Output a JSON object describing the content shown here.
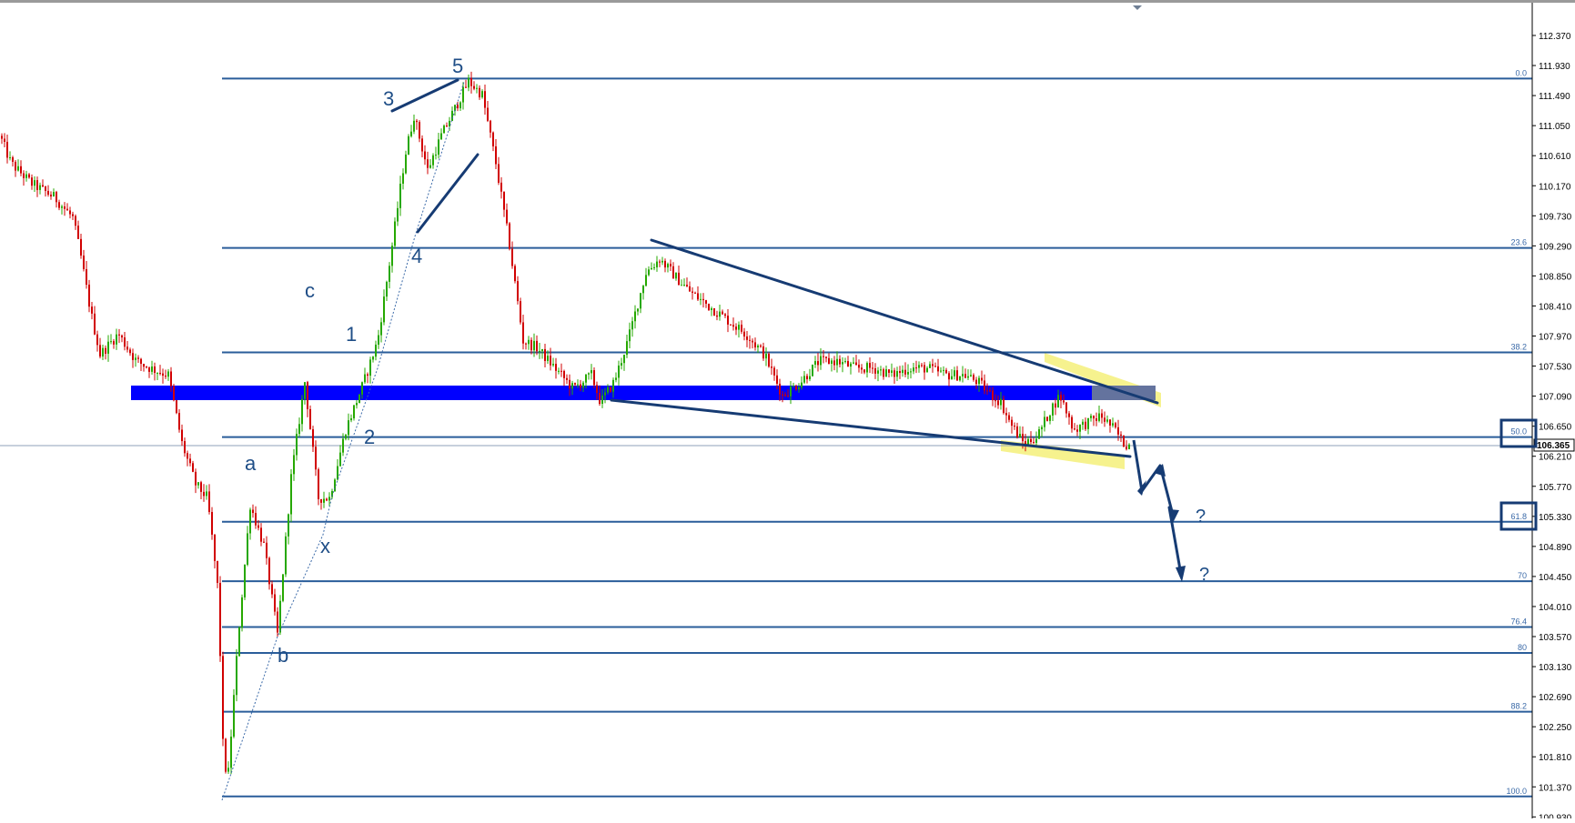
{
  "chart_data": {
    "type": "candlestick",
    "y_axis": {
      "ticks": [
        "112.370",
        "111.930",
        "111.490",
        "111.050",
        "110.610",
        "110.170",
        "109.730",
        "109.290",
        "108.850",
        "108.410",
        "107.970",
        "107.530",
        "107.090",
        "106.650",
        "106.210",
        "105.770",
        "105.330",
        "104.890",
        "104.450",
        "104.010",
        "103.570",
        "103.130",
        "102.690",
        "102.250",
        "101.810",
        "101.370",
        "100.930"
      ],
      "ylim": [
        100.93,
        112.37
      ]
    },
    "current_price": "106.365",
    "fib_levels": [
      {
        "label": "0.0",
        "price": 111.74
      },
      {
        "label": "23.6",
        "price": 109.26
      },
      {
        "label": "38.2",
        "price": 107.73
      },
      {
        "label": "50.0",
        "price": 106.49
      },
      {
        "label": "61.8",
        "price": 105.25
      },
      {
        "label": "70",
        "price": 104.38
      },
      {
        "label": "76.4",
        "price": 103.71
      },
      {
        "label": "80",
        "price": 103.33
      },
      {
        "label": "88.2",
        "price": 102.47
      },
      {
        "label": "100.0",
        "price": 101.23
      }
    ],
    "support_zone": {
      "low": 106.98,
      "high": 107.18,
      "color": "#0000ff"
    },
    "wave_labels": [
      "a",
      "b",
      "c",
      "x",
      "1",
      "2",
      "3",
      "4",
      "5"
    ],
    "projection_labels": [
      "?",
      "?"
    ],
    "colors": {
      "up": "#26a800",
      "down": "#d10000",
      "fib": "#2a5d9a",
      "trend": "#163b73",
      "highlight": "#f5f07a"
    }
  }
}
